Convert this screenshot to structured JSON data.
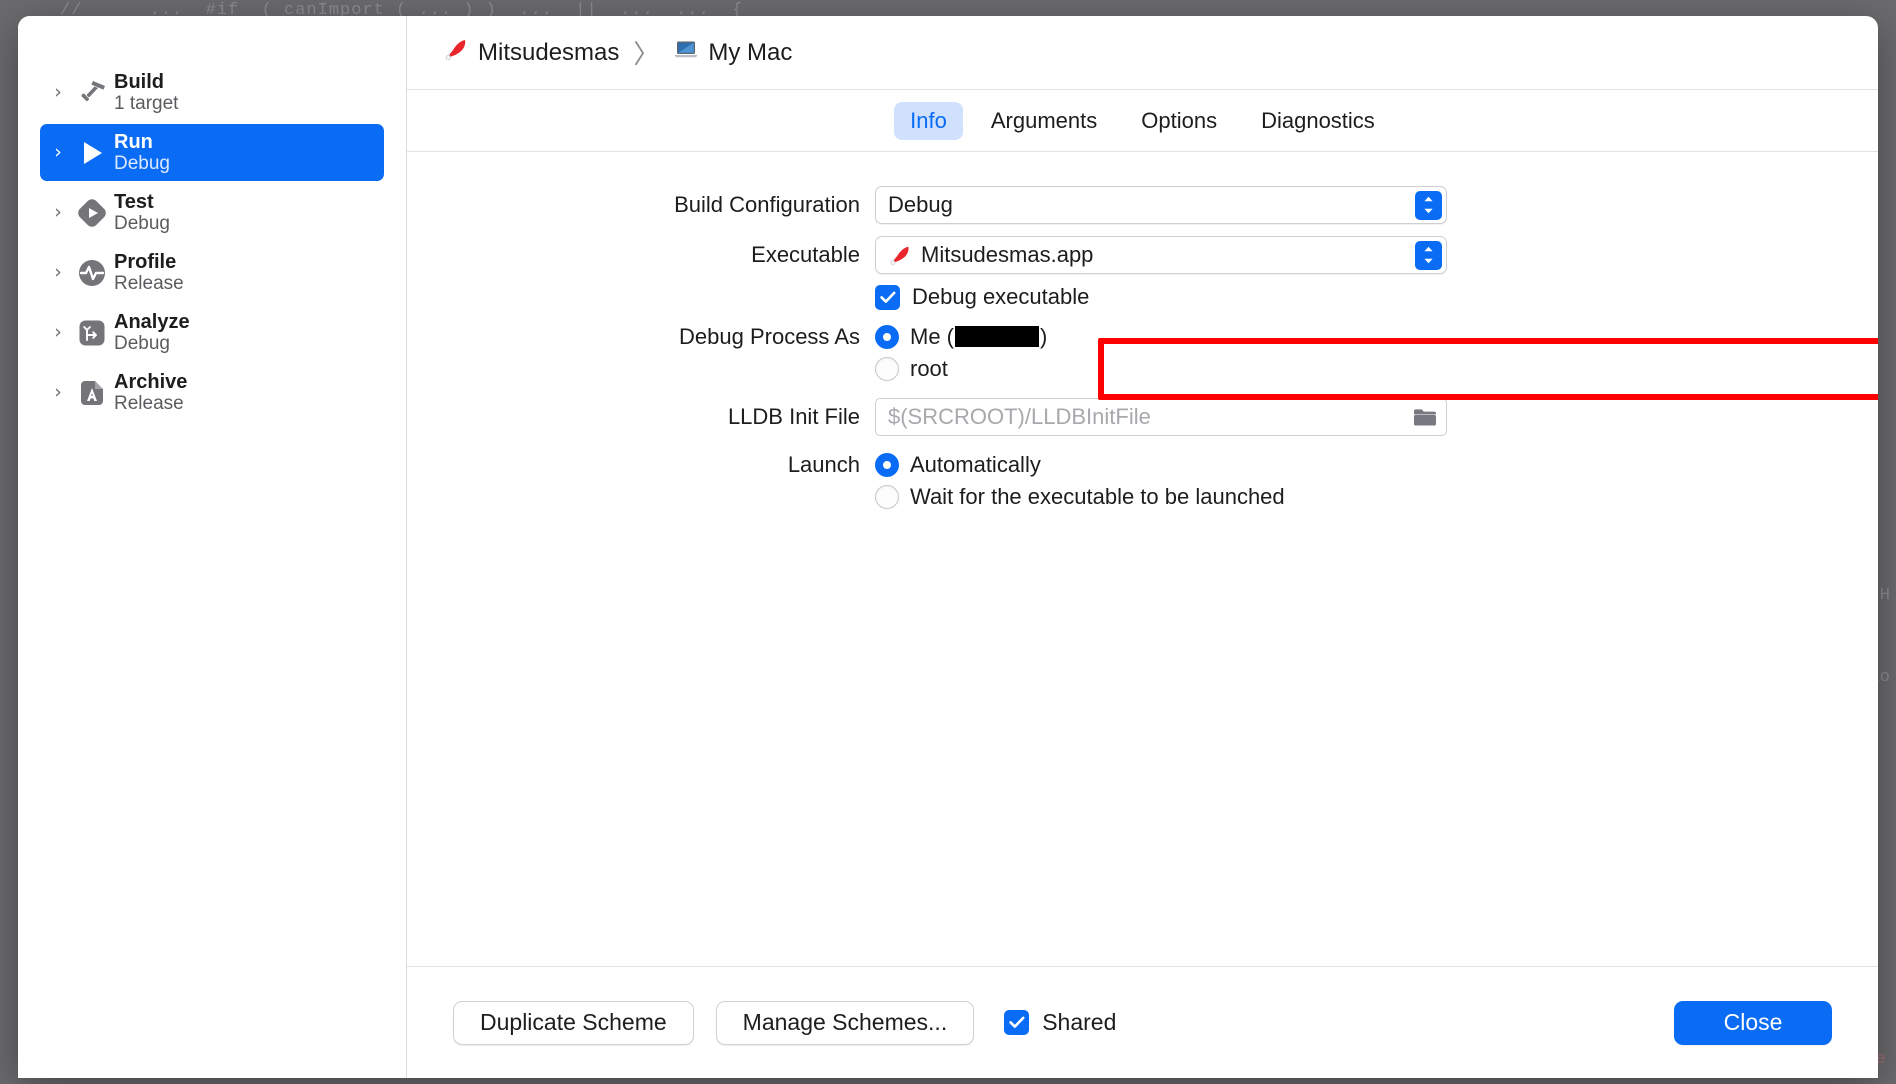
{
  "backdrop": {
    "code_top": "//      ...  #if  ( canImport ( ... ) )  ...  ||  ...  ...  {",
    "code_right_1": "sH",
    "code_right_2": "lo",
    "code_right_3": "re",
    "code_bottom_left": "}"
  },
  "sidebar": {
    "items": [
      {
        "title": "Build",
        "subtitle": "1 target",
        "icon": "hammer-icon",
        "selected": false
      },
      {
        "title": "Run",
        "subtitle": "Debug",
        "icon": "play-icon",
        "selected": true
      },
      {
        "title": "Test",
        "subtitle": "Debug",
        "icon": "test-diamond-icon",
        "selected": false
      },
      {
        "title": "Profile",
        "subtitle": "Release",
        "icon": "pulse-icon",
        "selected": false
      },
      {
        "title": "Analyze",
        "subtitle": "Debug",
        "icon": "analyze-icon",
        "selected": false
      },
      {
        "title": "Archive",
        "subtitle": "Release",
        "icon": "archive-icon",
        "selected": false
      }
    ]
  },
  "breadcrumb": {
    "scheme_name": "Mitsudesmas",
    "scheme_icon": "santa-hat-app-icon",
    "separator": "〉",
    "destination_name": "My Mac",
    "destination_icon": "laptop-icon"
  },
  "tabs": [
    {
      "label": "Info",
      "active": true
    },
    {
      "label": "Arguments",
      "active": false
    },
    {
      "label": "Options",
      "active": false
    },
    {
      "label": "Diagnostics",
      "active": false
    }
  ],
  "form": {
    "build_configuration": {
      "label": "Build Configuration",
      "value": "Debug",
      "control": "popup-button",
      "highlighted": true
    },
    "executable": {
      "label": "Executable",
      "value": "Mitsudesmas.app",
      "icon": "santa-hat-app-icon",
      "control": "popup-button"
    },
    "debug_executable": {
      "label": "Debug executable",
      "checked": true
    },
    "debug_process_as": {
      "label": "Debug Process As",
      "options": [
        {
          "label": "Me (",
          "redacted": true,
          "label_suffix": ")",
          "selected": true
        },
        {
          "label": "root",
          "redacted": false,
          "label_suffix": "",
          "selected": false
        }
      ]
    },
    "lldb_init_file": {
      "label": "LLDB Init File",
      "value": "",
      "placeholder": "$(SRCROOT)/LLDBInitFile",
      "browse_icon": "folder-icon"
    },
    "launch": {
      "label": "Launch",
      "options": [
        {
          "label": "Automatically",
          "selected": true
        },
        {
          "label": "Wait for the executable to be launched",
          "selected": false
        }
      ]
    }
  },
  "footer": {
    "duplicate_scheme": "Duplicate Scheme",
    "manage_schemes": "Manage Schemes...",
    "shared_label": "Shared",
    "shared_checked": true,
    "close": "Close"
  },
  "colors": {
    "accent": "#0a6cf5",
    "tab_active_bg": "#cfe1fd",
    "highlight": "#ff0000",
    "backdrop": "#6b6b6e"
  }
}
